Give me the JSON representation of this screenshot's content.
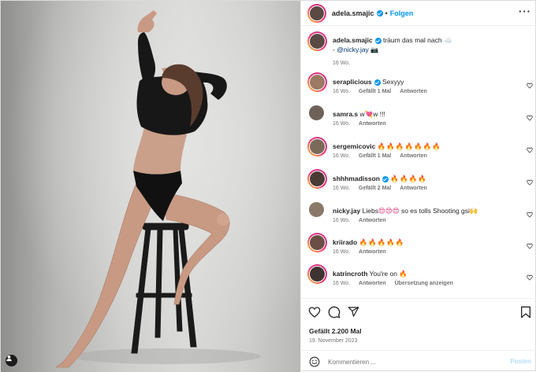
{
  "header": {
    "username": "adela.smajic",
    "separator": "•",
    "follow_label": "Folgen",
    "more_icon": "more-horizontal-icon"
  },
  "caption": {
    "username": "adela.smajic",
    "text": "träum das mal nach",
    "emoji_1": "☁️",
    "dash": "-",
    "mention": "@nicky.jay",
    "emoji_2": "📷",
    "time": "16 Wo."
  },
  "comments": [
    {
      "username": "seraplicious",
      "verified": true,
      "text": "Sexyyy",
      "time": "16 Wo.",
      "likes": "Gefällt 1 Mal",
      "reply": "Antworten"
    },
    {
      "username": "samra.s",
      "verified": false,
      "text_a": "w",
      "emoji": "💘",
      "text_b": "w !!!",
      "time": "16 Wo.",
      "reply": "Antworten"
    },
    {
      "username": "sergemicovic",
      "verified": false,
      "emoji": "🔥🔥🔥🔥🔥🔥🔥",
      "time": "16 Wo.",
      "likes": "Gefällt 1 Mal",
      "reply": "Antworten"
    },
    {
      "username": "shhhmadisson",
      "verified": true,
      "emoji": "🔥🔥🔥🔥",
      "time": "16 Wo.",
      "likes": "Gefällt 2 Mal",
      "reply": "Antworten"
    },
    {
      "username": "nicky.jay",
      "verified": false,
      "text_a": "Liebs",
      "emoji": "😍😍😍",
      "text_b": "so es tolls Shooting gsi",
      "emoji_2": "🙌",
      "time": "16 Wo.",
      "reply": "Antworten"
    },
    {
      "username": "kriirado",
      "verified": false,
      "emoji": "🔥🔥🔥🔥🔥",
      "time": "16 Wo.",
      "reply": "Antworten"
    },
    {
      "username": "katrincroth",
      "verified": false,
      "text": "You're on",
      "emoji": "🔥",
      "time": "16 Wo.",
      "reply": "Antworten",
      "translate": "Übersetzung anzeigen"
    }
  ],
  "actions": {
    "like_icon": "heart-icon",
    "comment_icon": "comment-icon",
    "share_icon": "send-icon",
    "save_icon": "bookmark-icon"
  },
  "likes": "Gefällt 2.200 Mal",
  "date": "19. November 2023",
  "add_comment": {
    "placeholder": "Kommentieren ...",
    "post_label": "Posten",
    "emoji_icon": "smiley-icon"
  },
  "colors": {
    "accent": "#0095f6",
    "text": "#262626",
    "muted": "#737373"
  }
}
